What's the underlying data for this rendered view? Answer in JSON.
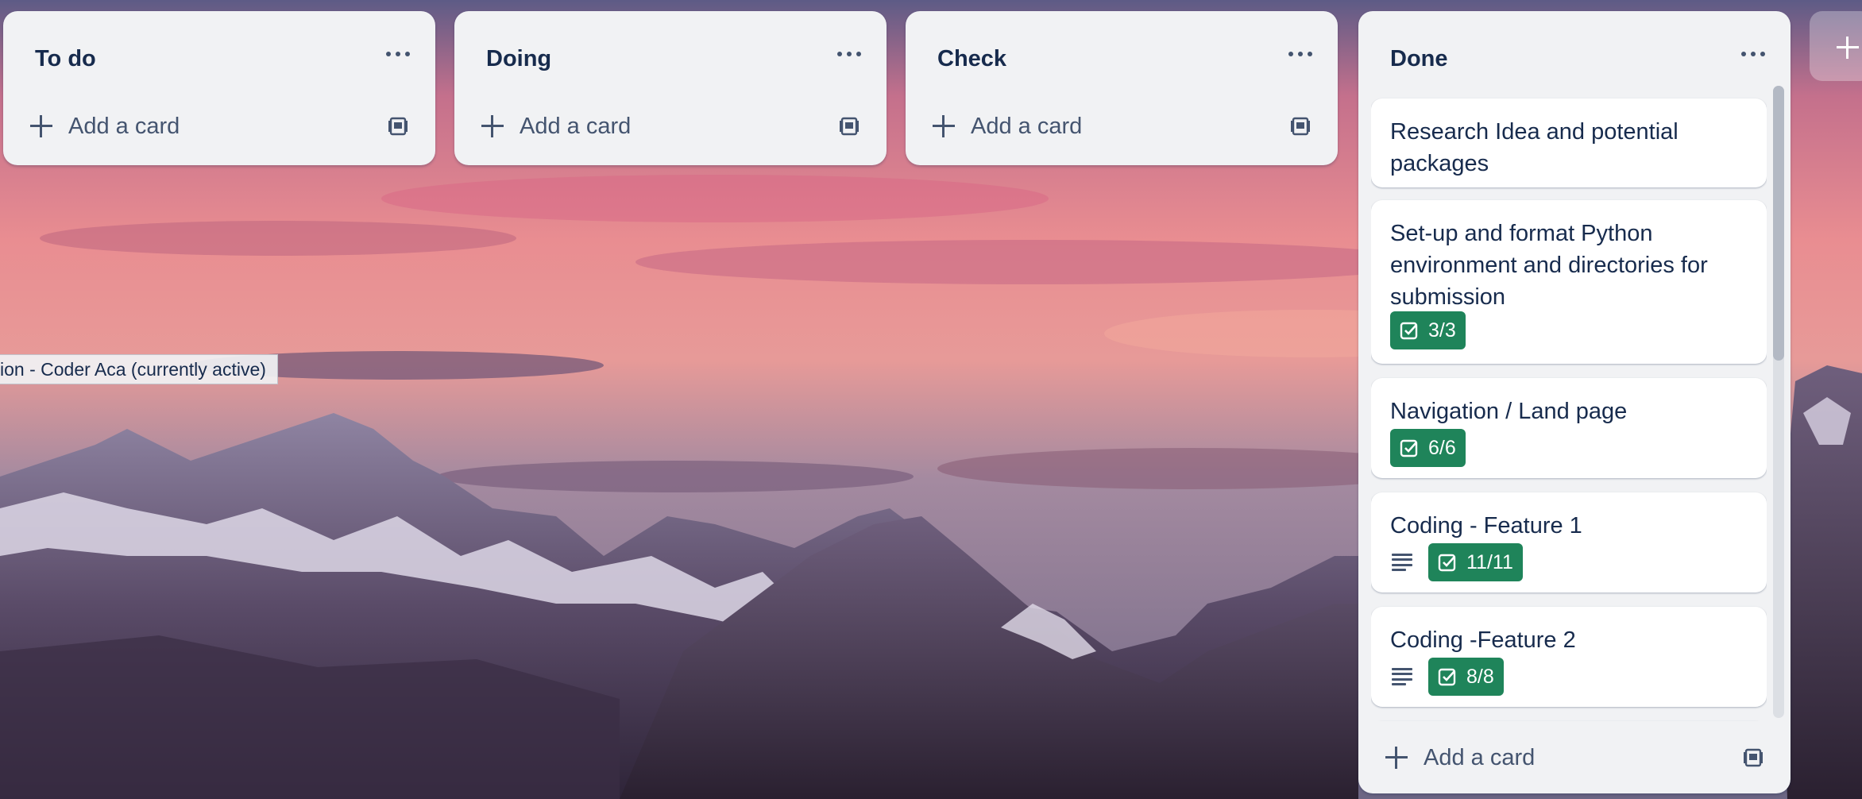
{
  "lists": [
    {
      "title": "To do",
      "add_label": "Add a card"
    },
    {
      "title": "Doing",
      "add_label": "Add a card"
    },
    {
      "title": "Check",
      "add_label": "Add a card"
    }
  ],
  "done_list": {
    "title": "Done",
    "add_label": "Add a card",
    "cards": [
      {
        "title": "Research Idea and potential packages"
      },
      {
        "title": "Set-up and format Python environment and directories for submission",
        "checklist": "3/3"
      },
      {
        "title": "Navigation / Land page",
        "checklist": "6/6"
      },
      {
        "title": "Coding - Feature 1",
        "has_description": true,
        "checklist": "11/11"
      },
      {
        "title": "Coding -Feature 2",
        "has_description": true,
        "checklist": "8/8"
      }
    ]
  },
  "tooltip": "ion - Coder Aca (currently active)",
  "icons": {
    "list_menu": "ellipsis-icon",
    "add": "plus-icon",
    "template": "card-template-icon",
    "checklist": "checkbox-icon",
    "description": "description-icon"
  },
  "colors": {
    "list_bg": "#f1f2f4",
    "text": "#172b4d",
    "badge_complete": "#1f845a"
  }
}
